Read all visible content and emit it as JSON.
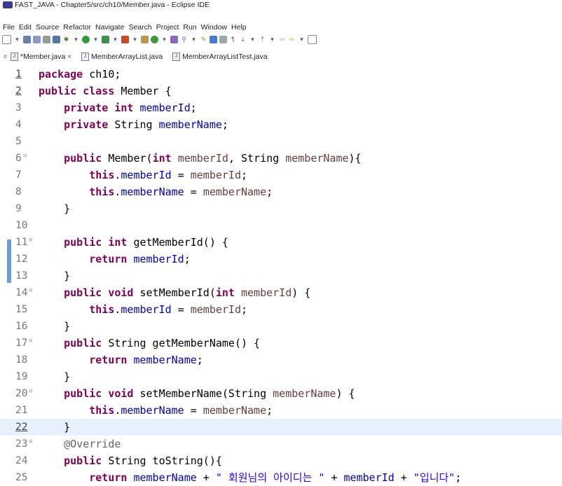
{
  "window": {
    "title": "FAST_JAVA - Chapter5/src/ch10/Member.java - Eclipse IDE"
  },
  "menu": [
    "File",
    "Edit",
    "Source",
    "Refactor",
    "Navigate",
    "Search",
    "Project",
    "Run",
    "Window",
    "Help"
  ],
  "tabs": [
    {
      "label": "*Member.java",
      "active": true,
      "closable": true
    },
    {
      "label": "MemberArrayList.java",
      "active": false
    },
    {
      "label": "MemberArrayListTest.java",
      "active": false
    }
  ],
  "editor": {
    "current_line": 22,
    "lines": [
      {
        "n": "1",
        "t": "package ch10;"
      },
      {
        "n": "2",
        "t": "public class Member {"
      },
      {
        "n": "3",
        "t": "    private int memberId;"
      },
      {
        "n": "4",
        "t": "    private String memberName;"
      },
      {
        "n": "5",
        "t": ""
      },
      {
        "n": "6",
        "t": "    public Member(int memberId, String memberName){"
      },
      {
        "n": "7",
        "t": "        this.memberId = memberId;"
      },
      {
        "n": "8",
        "t": "        this.memberName = memberName;"
      },
      {
        "n": "9",
        "t": "    }"
      },
      {
        "n": "10",
        "t": ""
      },
      {
        "n": "11",
        "t": "    public int getMemberId() {"
      },
      {
        "n": "12",
        "t": "        return memberId;"
      },
      {
        "n": "13",
        "t": "    }"
      },
      {
        "n": "14",
        "t": "    public void setMemberId(int memberId) {"
      },
      {
        "n": "15",
        "t": "        this.memberId = memberId;"
      },
      {
        "n": "16",
        "t": "    }"
      },
      {
        "n": "17",
        "t": "    public String getMemberName() {"
      },
      {
        "n": "18",
        "t": "        return memberName;"
      },
      {
        "n": "19",
        "t": "    }"
      },
      {
        "n": "20",
        "t": "    public void setMemberName(String memberName) {"
      },
      {
        "n": "21",
        "t": "        this.memberName = memberName;"
      },
      {
        "n": "22",
        "t": "    }"
      },
      {
        "n": "23",
        "t": "    @Override"
      },
      {
        "n": "24",
        "t": "    public String toString(){"
      },
      {
        "n": "25",
        "t": "        return memberName + \" 회원님의 아이디는 \" + memberId + \"입니다\";"
      }
    ]
  }
}
